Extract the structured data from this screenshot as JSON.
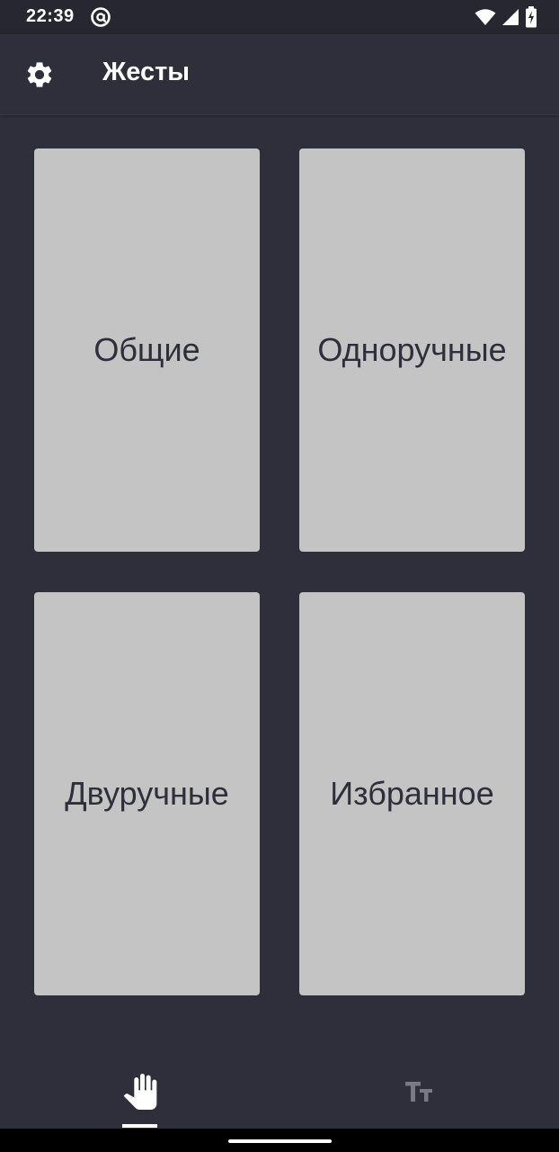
{
  "status_bar": {
    "time": "22:39",
    "icons": [
      "at-sign-icon",
      "wifi-icon",
      "signal-icon",
      "battery-charging-icon"
    ]
  },
  "app_bar": {
    "settings_icon": "gear-icon",
    "title": "Жесты"
  },
  "categories": [
    {
      "label": "Общие"
    },
    {
      "label": "Одноручные"
    },
    {
      "label": "Двуручные"
    },
    {
      "label": "Избранное"
    }
  ],
  "bottom_nav": {
    "items": [
      {
        "icon": "hand-icon",
        "selected": true
      },
      {
        "icon": "text-size-icon",
        "selected": false
      }
    ]
  },
  "colors": {
    "background": "#2f2f3c",
    "card": "#c4c4c4",
    "card_text": "#2f2f3c",
    "accent": "#ffffff",
    "inactive_icon": "#7a7a84"
  }
}
